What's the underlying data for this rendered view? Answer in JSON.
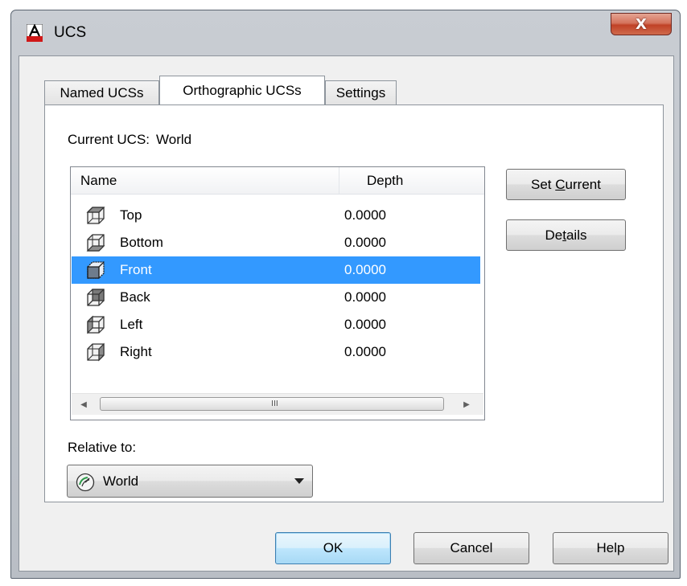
{
  "window": {
    "title": "UCS",
    "close_glyph": "X"
  },
  "tabs": [
    {
      "label": "Named UCSs",
      "active": false
    },
    {
      "label": "Orthographic UCSs",
      "active": true
    },
    {
      "label": "Settings",
      "active": false
    }
  ],
  "current_ucs": {
    "label": "Current UCS:",
    "value": "World"
  },
  "list": {
    "columns": [
      "Name",
      "Depth"
    ],
    "rows": [
      {
        "name": "Top",
        "depth": "0.0000",
        "icon": "cube-top-icon"
      },
      {
        "name": "Bottom",
        "depth": "0.0000",
        "icon": "cube-bottom-icon"
      },
      {
        "name": "Front",
        "depth": "0.0000",
        "icon": "cube-front-icon",
        "selected": true
      },
      {
        "name": "Back",
        "depth": "0.0000",
        "icon": "cube-back-icon"
      },
      {
        "name": "Left",
        "depth": "0.0000",
        "icon": "cube-left-icon"
      },
      {
        "name": "Right",
        "depth": "0.0000",
        "icon": "cube-right-icon"
      }
    ],
    "scroll_grip": "III"
  },
  "side_buttons": {
    "set_current": {
      "pre": "Set ",
      "mnemonic": "C",
      "post": "urrent"
    },
    "details": {
      "pre": "De",
      "mnemonic": "t",
      "post": "ails"
    }
  },
  "relative_to": {
    "label": "Relative to:",
    "value": "World",
    "icon": "world-ucs-icon"
  },
  "footer": {
    "ok": "OK",
    "cancel": "Cancel",
    "help": "Help"
  },
  "colors": {
    "selection": "#3399ff",
    "close_button": "#c74b32"
  }
}
